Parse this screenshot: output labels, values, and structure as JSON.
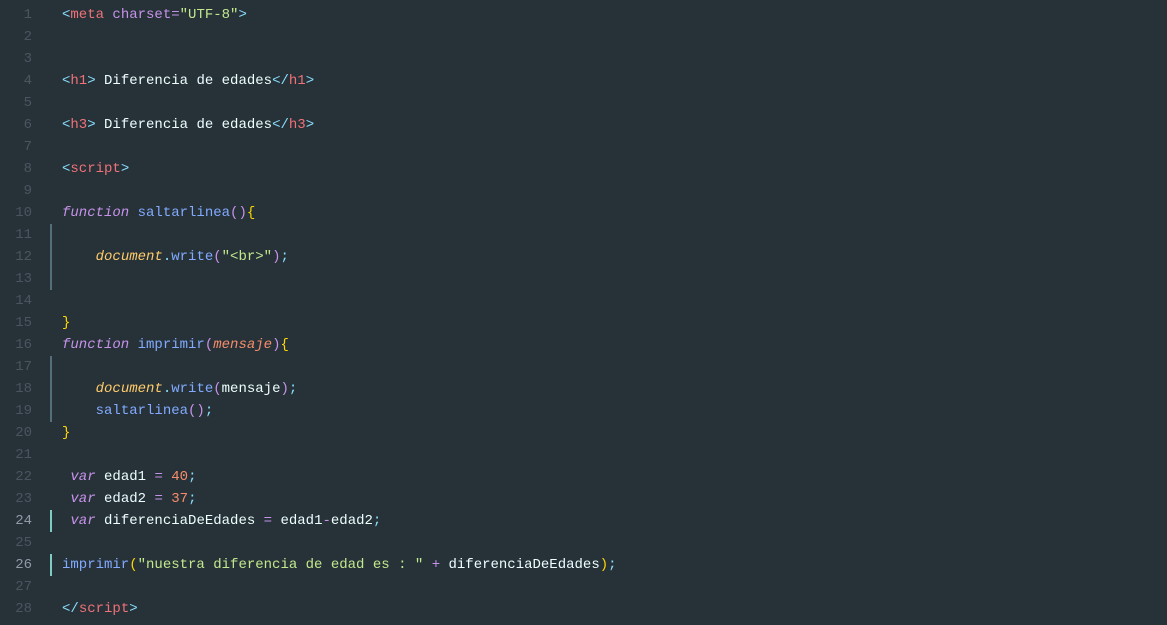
{
  "code": {
    "lines": [
      {
        "num": 1,
        "cls": "",
        "tokens": [
          [
            "punct",
            "<"
          ],
          [
            "tag-name",
            "meta"
          ],
          [
            "plain",
            " "
          ],
          [
            "attr",
            "charset"
          ],
          [
            "op",
            "="
          ],
          [
            "string",
            "\"UTF-8\""
          ],
          [
            "punct",
            ">"
          ]
        ]
      },
      {
        "num": 2,
        "cls": "",
        "tokens": []
      },
      {
        "num": 3,
        "cls": "",
        "tokens": []
      },
      {
        "num": 4,
        "cls": "",
        "tokens": [
          [
            "punct",
            "<"
          ],
          [
            "tag-name",
            "h1"
          ],
          [
            "punct",
            ">"
          ],
          [
            "plain",
            " Diferencia de edades"
          ],
          [
            "punct",
            "</"
          ],
          [
            "tag-name",
            "h1"
          ],
          [
            "punct",
            ">"
          ]
        ]
      },
      {
        "num": 5,
        "cls": "",
        "tokens": []
      },
      {
        "num": 6,
        "cls": "",
        "tokens": [
          [
            "punct",
            "<"
          ],
          [
            "tag-name",
            "h3"
          ],
          [
            "punct",
            ">"
          ],
          [
            "plain",
            " Diferencia de edades"
          ],
          [
            "punct",
            "</"
          ],
          [
            "tag-name",
            "h3"
          ],
          [
            "punct",
            ">"
          ]
        ]
      },
      {
        "num": 7,
        "cls": "",
        "tokens": []
      },
      {
        "num": 8,
        "cls": "",
        "tokens": [
          [
            "punct",
            "<"
          ],
          [
            "tag-name",
            "script"
          ],
          [
            "punct",
            ">"
          ]
        ]
      },
      {
        "num": 9,
        "cls": "",
        "tokens": []
      },
      {
        "num": 10,
        "cls": "",
        "tokens": [
          [
            "keyword",
            "function"
          ],
          [
            "plain",
            " "
          ],
          [
            "func-name",
            "saltarlinea"
          ],
          [
            "paren-p",
            "()"
          ],
          [
            "brace",
            "{"
          ]
        ]
      },
      {
        "num": 11,
        "cls": "mark",
        "tokens": []
      },
      {
        "num": 12,
        "cls": "mark",
        "tokens": [
          [
            "plain",
            "    "
          ],
          [
            "obj",
            "document"
          ],
          [
            "punct",
            "."
          ],
          [
            "method",
            "write"
          ],
          [
            "paren-p",
            "("
          ],
          [
            "string",
            "\"<br>\""
          ],
          [
            "paren-p",
            ")"
          ],
          [
            "punct",
            ";"
          ]
        ]
      },
      {
        "num": 13,
        "cls": "mark",
        "tokens": []
      },
      {
        "num": 14,
        "cls": "",
        "tokens": []
      },
      {
        "num": 15,
        "cls": "",
        "tokens": [
          [
            "brace",
            "}"
          ]
        ]
      },
      {
        "num": 16,
        "cls": "",
        "tokens": [
          [
            "keyword",
            "function"
          ],
          [
            "plain",
            " "
          ],
          [
            "func-name",
            "imprimir"
          ],
          [
            "paren-p",
            "("
          ],
          [
            "param",
            "mensaje"
          ],
          [
            "paren-p",
            ")"
          ],
          [
            "brace",
            "{"
          ]
        ]
      },
      {
        "num": 17,
        "cls": "mark",
        "tokens": []
      },
      {
        "num": 18,
        "cls": "mark",
        "tokens": [
          [
            "plain",
            "    "
          ],
          [
            "obj",
            "document"
          ],
          [
            "punct",
            "."
          ],
          [
            "method",
            "write"
          ],
          [
            "paren-p",
            "("
          ],
          [
            "plain",
            "mensaje"
          ],
          [
            "paren-p",
            ")"
          ],
          [
            "punct",
            ";"
          ]
        ]
      },
      {
        "num": 19,
        "cls": "mark",
        "tokens": [
          [
            "plain",
            "    "
          ],
          [
            "method",
            "saltarlinea"
          ],
          [
            "paren-p",
            "()"
          ],
          [
            "punct",
            ";"
          ]
        ]
      },
      {
        "num": 20,
        "cls": "",
        "tokens": [
          [
            "brace",
            "}"
          ]
        ]
      },
      {
        "num": 21,
        "cls": "",
        "tokens": []
      },
      {
        "num": 22,
        "cls": "",
        "tokens": [
          [
            "plain",
            " "
          ],
          [
            "keyword",
            "var"
          ],
          [
            "plain",
            " edad1 "
          ],
          [
            "op",
            "="
          ],
          [
            "plain",
            " "
          ],
          [
            "number",
            "40"
          ],
          [
            "punct",
            ";"
          ]
        ]
      },
      {
        "num": 23,
        "cls": "",
        "tokens": [
          [
            "plain",
            " "
          ],
          [
            "keyword",
            "var"
          ],
          [
            "plain",
            " edad2 "
          ],
          [
            "op",
            "="
          ],
          [
            "plain",
            " "
          ],
          [
            "number",
            "37"
          ],
          [
            "punct",
            ";"
          ]
        ]
      },
      {
        "num": 24,
        "cls": "active",
        "tokens": [
          [
            "plain",
            " "
          ],
          [
            "keyword",
            "var"
          ],
          [
            "plain",
            " diferenciaDeEdades "
          ],
          [
            "op",
            "="
          ],
          [
            "plain",
            " edad1"
          ],
          [
            "op",
            "-"
          ],
          [
            "plain",
            "edad2"
          ],
          [
            "punct",
            ";"
          ]
        ]
      },
      {
        "num": 25,
        "cls": "",
        "tokens": []
      },
      {
        "num": 26,
        "cls": "active",
        "tokens": [
          [
            "method",
            "imprimir"
          ],
          [
            "brace",
            "("
          ],
          [
            "string",
            "\"nuestra diferencia de edad es : \""
          ],
          [
            "plain",
            " "
          ],
          [
            "op",
            "+"
          ],
          [
            "plain",
            " diferenciaDeEdades"
          ],
          [
            "brace",
            ")"
          ],
          [
            "punct",
            ";"
          ]
        ]
      },
      {
        "num": 27,
        "cls": "",
        "tokens": []
      },
      {
        "num": 28,
        "cls": "",
        "tokens": [
          [
            "punct",
            "</"
          ],
          [
            "tag-name",
            "script"
          ],
          [
            "punct",
            ">"
          ]
        ]
      }
    ]
  }
}
